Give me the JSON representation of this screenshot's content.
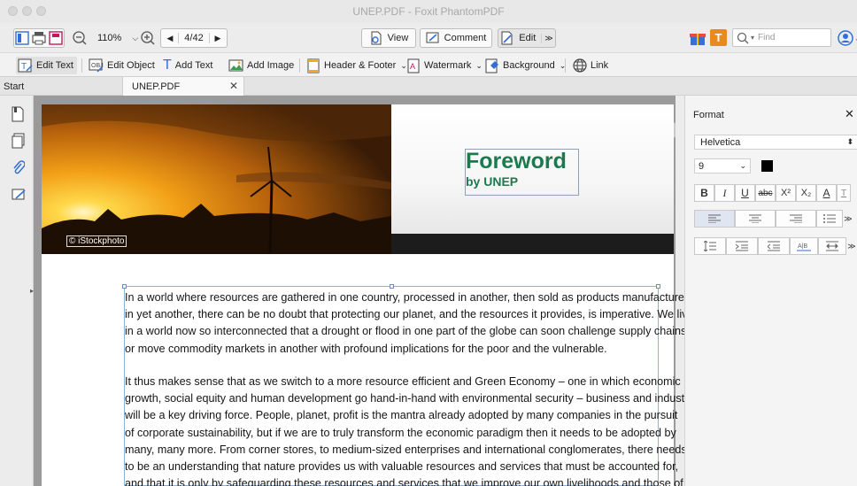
{
  "window": {
    "title": "UNEP.PDF - Foxit PhantomPDF"
  },
  "toolbar": {
    "zoom": "110%",
    "page_indicator": "4/42",
    "view_label": "View",
    "comment_label": "Comment",
    "edit_label": "Edit",
    "find_placeholder": "Find"
  },
  "edit_toolbar": {
    "edit_text": "Edit Text",
    "edit_object": "Edit Object",
    "add_text": "Add Text",
    "add_image": "Add Image",
    "header_footer": "Header & Footer",
    "watermark": "Watermark",
    "background": "Background",
    "link": "Link"
  },
  "tabs": {
    "start": "Start",
    "file": "UNEP.PDF"
  },
  "document": {
    "heading": "Foreword",
    "subheading": "by UNEP",
    "photo_credit": "© iStockphoto",
    "paragraph1": [
      "In a world where resources are gathered in one country, processed in another, then sold as products manufactured",
      "in yet another, there can be no doubt that protecting our planet, and the resources it provides, is imperative. We live",
      "in a world now so interconnected that a drought or flood in one part of the globe can soon challenge supply chains",
      "or move commodity markets in another with profound implications for the poor and the vulnerable."
    ],
    "paragraph2": [
      "It thus makes sense that as we switch to a more resource efficient and Green Economy – one in which economic",
      "growth, social equity and human development go hand-in-hand with environmental security – business and industry",
      "will be a key driving force. People, planet, profit is the mantra already adopted by many companies in the pursuit",
      "of corporate sustainability, but if we are to truly transform the economic paradigm then it needs to be adopted by",
      "many, many more. From corner stores, to medium-sized enterprises and international conglomerates, there needs",
      "to be an understanding that nature provides us with valuable resources and services that must be accounted for,",
      "and that it is only by safeguarding these resources and services that we improve our own livelihoods and those of"
    ]
  },
  "format_panel": {
    "title": "Format",
    "font": "Helvetica",
    "size": "9",
    "color": "#000000",
    "style_buttons": [
      "B",
      "I",
      "U",
      "abc",
      "X²",
      "X₂",
      "A",
      "T"
    ]
  },
  "colors": {
    "heading_green": "#1b7a4e",
    "accent_blue": "#2f6fd6"
  }
}
